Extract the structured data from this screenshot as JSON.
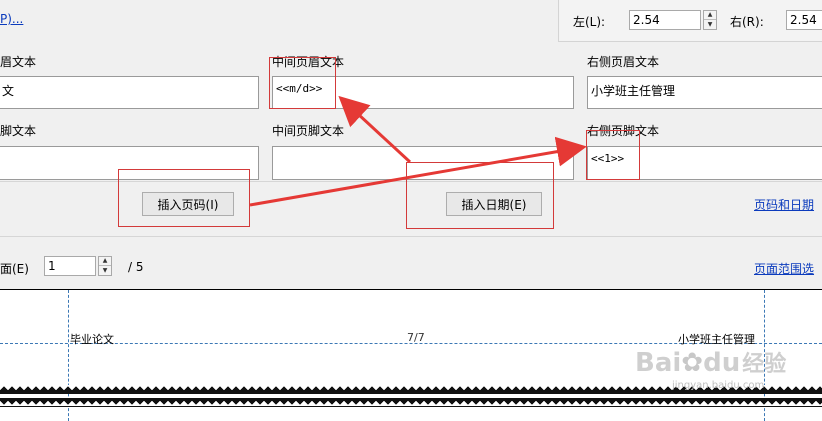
{
  "top": {
    "partial_link": "P)...",
    "margin_left_label": "左(L):",
    "margin_left_value": "2.54",
    "margin_right_label": "右(R):",
    "margin_right_value": "2.54"
  },
  "header": {
    "left_label": "眉文本",
    "left_value": "文",
    "center_label": "中间页眉文本",
    "center_value": "<<m/d>>",
    "right_label": "右侧页眉文本",
    "right_value": "小学班主任管理"
  },
  "footer": {
    "left_label": "脚文本",
    "left_value": "",
    "center_label": "中间页脚文本",
    "center_value": "",
    "right_label": "右侧页脚文本",
    "right_value": "<<1>>"
  },
  "buttons": {
    "insert_page_number": "插入页码(I)",
    "insert_date": "插入日期(E)",
    "page_date_link": "页码和日期"
  },
  "pager": {
    "label": "面(E)",
    "value": "1",
    "total": "/ 5",
    "page_range_link": "页面范围选"
  },
  "preview": {
    "left_text": "毕业论文",
    "center_text": "7/7",
    "right_text": "小学班主任管理",
    "watermark_main": "Bai",
    "watermark_paw": "du",
    "watermark_cn": "经验",
    "watermark_sub": "jingyan.baidu.com"
  },
  "colors": {
    "annotation_red": "#e53935",
    "guide_blue": "#3c78b5",
    "link_blue": "#0b3bbd"
  }
}
